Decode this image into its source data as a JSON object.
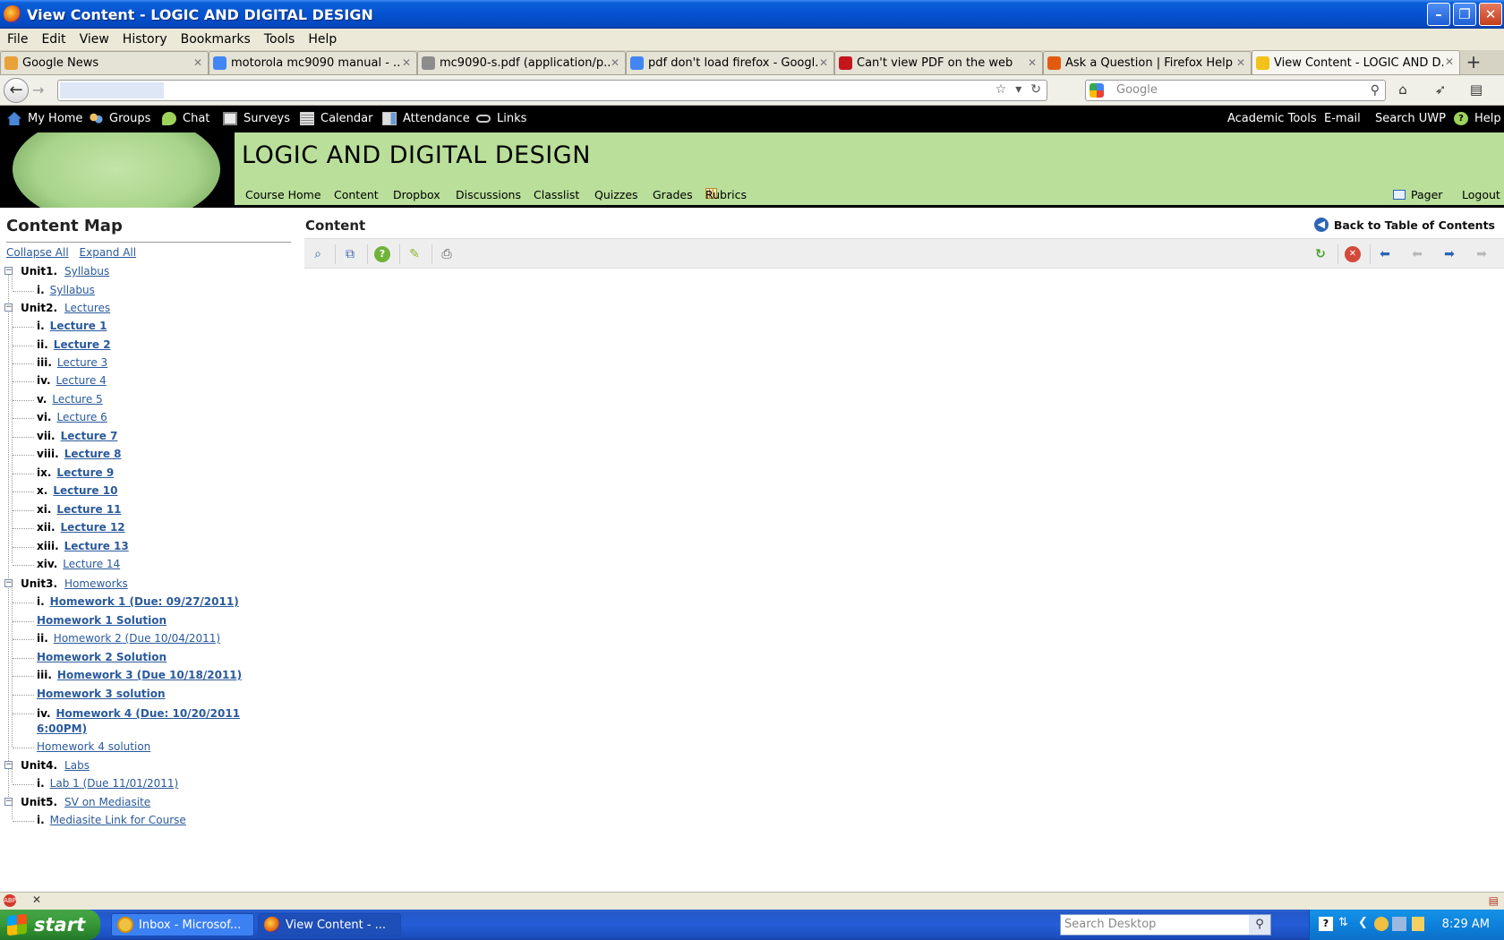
{
  "window": {
    "title": "View Content - LOGIC AND DIGITAL DESIGN"
  },
  "menu": [
    "File",
    "Edit",
    "View",
    "History",
    "Bookmarks",
    "Tools",
    "Help"
  ],
  "tabs": [
    {
      "title": "Google News",
      "color": "#e8a23a"
    },
    {
      "title": "motorola mc9090 manual - ...",
      "color": "#4285f4"
    },
    {
      "title": "mc9090-s.pdf (application/p...",
      "color": "#8c8c8c"
    },
    {
      "title": "pdf don't load firefox - Googl...",
      "color": "#4285f4"
    },
    {
      "title": "Can't view PDF on the web",
      "color": "#c4161c"
    },
    {
      "title": "Ask a Question | Firefox Help",
      "color": "#e25a0f"
    },
    {
      "title": "View Content - LOGIC AND D...",
      "color": "#f2c21b"
    }
  ],
  "search": {
    "placeholder": "Google"
  },
  "site": {
    "left_links": [
      "My Home",
      "Groups",
      "Chat",
      "Surveys",
      "Calendar",
      "Attendance",
      "Links"
    ],
    "right_links": [
      "Academic Tools",
      "E-mail",
      "Search UWP",
      "Help"
    ],
    "course_title": "LOGIC AND DIGITAL DESIGN",
    "course_nav": [
      "Course Home",
      "Content",
      "Dropbox",
      "Discussions",
      "Classlist",
      "Quizzes",
      "Grades",
      "Rubrics"
    ],
    "pager": "Pager",
    "logout": "Logout"
  },
  "content_map": {
    "title": "Content Map",
    "collapse_all": "Collapse All",
    "expand_all": "Expand All",
    "units": [
      {
        "label": "Unit1.",
        "name": "Syllabus"
      },
      {
        "label": "Unit2.",
        "name": "Lectures"
      },
      {
        "label": "Unit3.",
        "name": "Homeworks"
      },
      {
        "label": "Unit4.",
        "name": "Labs"
      },
      {
        "label": "Unit5.",
        "name": "SV on Mediasite"
      }
    ],
    "items": [
      {
        "num": "i.",
        "text": "Syllabus"
      },
      {
        "num": "i.",
        "text": "Lecture 1"
      },
      {
        "num": "ii.",
        "text": "Lecture 2"
      },
      {
        "num": "iii.",
        "text": "Lecture 3"
      },
      {
        "num": "iv.",
        "text": "Lecture 4"
      },
      {
        "num": "v.",
        "text": "Lecture 5"
      },
      {
        "num": "vi.",
        "text": "Lecture 6"
      },
      {
        "num": "vii.",
        "text": "Lecture 7"
      },
      {
        "num": "viii.",
        "text": "Lecture 8"
      },
      {
        "num": "ix.",
        "text": "Lecture 9"
      },
      {
        "num": "x.",
        "text": "Lecture 10"
      },
      {
        "num": "xi.",
        "text": "Lecture 11"
      },
      {
        "num": "xii.",
        "text": "Lecture 12"
      },
      {
        "num": "xiii.",
        "text": "Lecture 13"
      },
      {
        "num": "xiv.",
        "text": "Lecture 14"
      },
      {
        "num": "i.",
        "text": "Homework 1 (Due: 09/27/2011)"
      },
      {
        "num": "",
        "text": "Homework 1 Solution"
      },
      {
        "num": "ii.",
        "text": "Homework 2 (Due 10/04/2011)"
      },
      {
        "num": "",
        "text": "Homework 2 Solution"
      },
      {
        "num": "iii.",
        "text": "Homework 3 (Due 10/18/2011)"
      },
      {
        "num": "",
        "text": "Homework 3 solution"
      },
      {
        "num": "iv.",
        "text": "Homework 4 (Due: 10/20/2011",
        "text2": "6:00PM)"
      },
      {
        "num": "",
        "text": "Homework 4 solution"
      },
      {
        "num": "i.",
        "text": "Lab 1 (Due 11/01/2011)"
      },
      {
        "num": "i.",
        "text": "Mediasite Link for Course"
      }
    ]
  },
  "content": {
    "title": "Content",
    "back_to_toc": "Back to Table of Contents"
  },
  "taskbar": {
    "start": "start",
    "items": [
      "Inbox - Microsof...",
      "View Content - ..."
    ],
    "search_placeholder": "Search Desktop",
    "clock": "8:29 AM"
  }
}
